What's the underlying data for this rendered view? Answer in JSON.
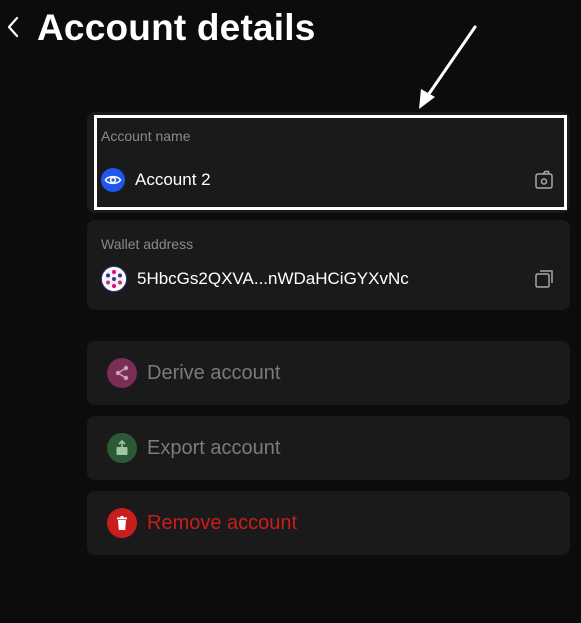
{
  "header": {
    "title": "Account details"
  },
  "account_name": {
    "label": "Account name",
    "value": "Account 2"
  },
  "wallet_address": {
    "label": "Wallet address",
    "value": "5HbcGs2QXVA...nWDaHCiGYXvNc"
  },
  "actions": {
    "derive": "Derive account",
    "export": "Export account",
    "remove": "Remove account"
  },
  "colors": {
    "background": "#0c0c0c",
    "card": "#1a1a1a",
    "label": "#8a8a8a",
    "eye_badge": "#1e56f0",
    "derive_badge": "#7a2d55",
    "export_badge": "#2d5a36",
    "remove_badge": "#c81e1e",
    "remove_text": "#c81e1e",
    "muted_text": "#7b7b7b"
  },
  "icons": {
    "back": "chevron-left-icon",
    "eye": "eye-icon",
    "edit": "edit-icon",
    "address_avatar": "polkadot-identicon",
    "copy": "copy-icon",
    "derive": "share-icon",
    "export": "export-icon",
    "remove": "trash-icon"
  }
}
